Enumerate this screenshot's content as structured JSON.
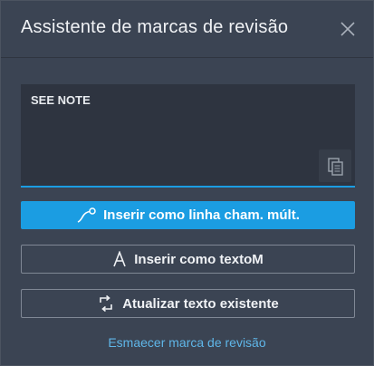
{
  "dialog": {
    "title": "Assistente de marcas de revisão",
    "close_icon": "close-icon"
  },
  "note": {
    "value": "SEE NOTE",
    "paste_icon": "paste-icon"
  },
  "buttons": {
    "insert_multileader": "Inserir como linha cham. múlt.",
    "insert_mtext": "Inserir como textoM",
    "update_text": "Atualizar texto existente"
  },
  "link": {
    "fade_markup": "Esmaecer marca de revisão"
  },
  "colors": {
    "accent": "#1b9de2",
    "link": "#5fb6e8",
    "background": "#3b4453"
  }
}
